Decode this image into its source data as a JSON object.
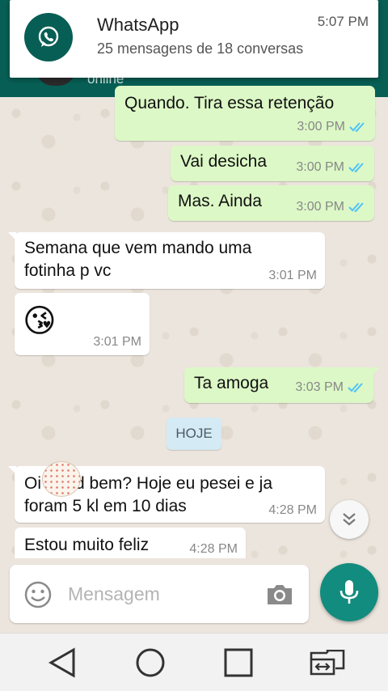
{
  "header": {
    "status": "online"
  },
  "notification": {
    "app": "WhatsApp",
    "time": "5:07 PM",
    "text": "25 mensagens de 18 conversas",
    "icon": "whatsapp-icon"
  },
  "messages": [
    {
      "text": "Quando. Tira essa retenção",
      "time": "3:00 PM"
    },
    {
      "text": "Vai desicha",
      "time": "3:00 PM"
    },
    {
      "text": "Mas.  Ainda",
      "time": "3:00 PM"
    },
    {
      "line1": "Semana que vem mando uma",
      "line2": "fotinha p vc",
      "time": "3:01 PM"
    },
    {
      "emoji": "😘",
      "time": "3:01 PM"
    },
    {
      "text": "Ta amoga",
      "time": "3:03 PM"
    },
    {
      "line1_start": "Oi",
      "line1_end": "d bem? Hoje eu pesei e ja",
      "line2": "foram 5 kl em 10 dias",
      "time": "4:28 PM"
    },
    {
      "text": "Estou muito feliz",
      "time": "4:28 PM"
    }
  ],
  "day_divider": "HOJE",
  "composer": {
    "placeholder": "Mensagem"
  },
  "colors": {
    "header": "#075e54",
    "outgoing": "#dcf8c6",
    "incoming": "#ffffff",
    "read_ticks": "#4fc3f7",
    "mic": "#128c7e"
  }
}
